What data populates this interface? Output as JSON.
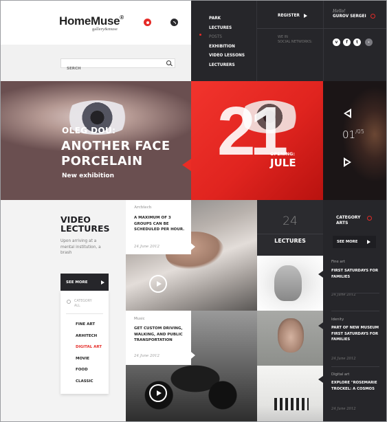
{
  "brand": {
    "name": "HomeMuse",
    "reg": "®",
    "tagline": "gallery&muse"
  },
  "search": {
    "placeholder": "SERCH"
  },
  "nav": {
    "items": [
      {
        "label": "PARK"
      },
      {
        "label": "LECTURES"
      },
      {
        "label": "POSTS"
      },
      {
        "label": "EXHIBITION"
      },
      {
        "label": "VIDEO LESSONS"
      },
      {
        "label": "LECTURERS"
      }
    ],
    "register": "REGISTER",
    "social_label_1": "WE IN",
    "social_label_2": "SOCIAL NETWORKS:",
    "hello": "Hello!",
    "user": "GUROV SERGEI"
  },
  "hero": {
    "artist": "OLEG DOU:",
    "title_1": "ANOTHER FACE",
    "title_2": "PORCELAIN",
    "subtitle": "New exhibition",
    "date_day": "21",
    "opening": "OPENING:",
    "month": "JULE",
    "counter_current": "01",
    "counter_total": "/05"
  },
  "video_lectures": {
    "title_1": "VIDEO",
    "title_2": "LECTURES",
    "desc": "Upon arriving at a mental institution, a brash",
    "see_more": "SEE MORE",
    "category_1": "CATEGORY",
    "category_2": "ALL",
    "categories": [
      {
        "label": "FINE ART"
      },
      {
        "label": "ARHITECH"
      },
      {
        "label": "DIGITAL ART"
      },
      {
        "label": "MOVIE"
      },
      {
        "label": "FOOD"
      },
      {
        "label": "CLASSIC"
      }
    ]
  },
  "cards": [
    {
      "category": "Archtech",
      "text": "A MAXIMUM OF 3 GROUPS CAN BE SCHEDULED PER HOUR.",
      "date": "24 June 2012"
    },
    {
      "category": "Music",
      "text": "GET CUSTOM DRIVING, WALKING, AND PUBLIC TRANSPORTATION",
      "date": "24 June 2012"
    }
  ],
  "lectures_box": {
    "number": "24",
    "label": "LECTURES"
  },
  "category_arts": {
    "label_1": "CATEGORY",
    "label_2": "ARTS",
    "see_more": "SEE MORE"
  },
  "side_items": [
    {
      "category": "Fine art",
      "title": "FIRST SATURDAYS FOR FAMILIES",
      "date": "24 June 2012"
    },
    {
      "category": "Idenity",
      "title": "PART OF NEW MUSEUM FIRST SATURDAYS FOR FAMILIES",
      "date": "24 June 2012"
    },
    {
      "category": "Digital art",
      "title": "EXPLORE \"ROSEMARIE TROCKEL: A COSMOS",
      "date": "24 June 2012"
    }
  ],
  "colors": {
    "accent": "#e52c28",
    "dark": "#26262a"
  }
}
